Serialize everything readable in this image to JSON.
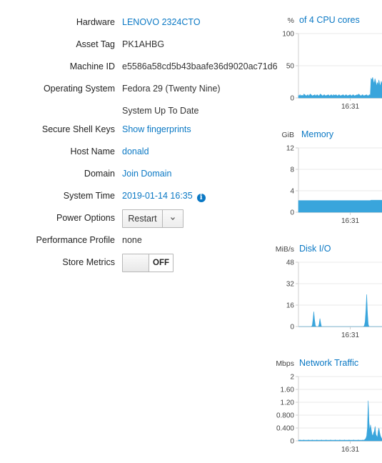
{
  "system": {
    "hardware": {
      "label": "Hardware",
      "value": "LENOVO 2324CTO"
    },
    "asset_tag": {
      "label": "Asset Tag",
      "value": "PK1AHBG"
    },
    "machine_id": {
      "label": "Machine ID",
      "value": "e5586a58cd5b43baafe36d9020ac71d6"
    },
    "os": {
      "label": "Operating System",
      "value": "Fedora 29 (Twenty Nine)",
      "status": "System Up To Date"
    },
    "ssh": {
      "label": "Secure Shell Keys",
      "value": "Show fingerprints"
    },
    "host": {
      "label": "Host Name",
      "value": "donald"
    },
    "domain": {
      "label": "Domain",
      "value": "Join Domain"
    },
    "time": {
      "label": "System Time",
      "value": "2019-01-14 16:35",
      "info_icon": "info-icon"
    },
    "power": {
      "label": "Power Options",
      "button": "Restart",
      "caret_icon": "chevron-down-icon"
    },
    "profile": {
      "label": "Performance Profile",
      "value": "none"
    },
    "metrics": {
      "label": "Store Metrics",
      "state": "OFF"
    }
  },
  "colors": {
    "link": "#0a78c4",
    "area": "#39a5dc"
  },
  "chart_data": [
    {
      "type": "area",
      "unit": "%",
      "title": "of 4 CPU cores",
      "y_ticks": [
        "100",
        "50",
        "0"
      ],
      "ylim": [
        0,
        100
      ],
      "x_tick": "16:31",
      "values": [
        4,
        3,
        5,
        3,
        4,
        4,
        3,
        6,
        5,
        4,
        3,
        4,
        5,
        3,
        4,
        6,
        5,
        4,
        3,
        4,
        4,
        5,
        3,
        4,
        5,
        4,
        3,
        4,
        6,
        5,
        4,
        3,
        4,
        5,
        4,
        3,
        4,
        4,
        5,
        4,
        3,
        4,
        5,
        4,
        3,
        5,
        4,
        4,
        5,
        4,
        3,
        4,
        5,
        4,
        3,
        4,
        4,
        5,
        4,
        3,
        4,
        5,
        4,
        3,
        4,
        4,
        5,
        4,
        3,
        4,
        5,
        4,
        3,
        4,
        4,
        5,
        4,
        6,
        5,
        4,
        3,
        4,
        5,
        4,
        3,
        4,
        4,
        5,
        4,
        3,
        4,
        5,
        4,
        30,
        28,
        32,
        26,
        22,
        30,
        25,
        18,
        24,
        20,
        28,
        22,
        18,
        26,
        22
      ]
    },
    {
      "type": "area",
      "unit": "GiB",
      "title": "Memory",
      "y_ticks": [
        "12",
        "8",
        "4",
        "0"
      ],
      "ylim": [
        0,
        16
      ],
      "x_tick": "16:31",
      "values": [
        2.9,
        2.9,
        2.9,
        2.9,
        2.9,
        2.9,
        2.9,
        2.9,
        2.9,
        2.9,
        2.9,
        2.9,
        2.9,
        2.9,
        2.9,
        2.9,
        2.9,
        2.9,
        2.9,
        2.9,
        2.9,
        2.9,
        2.9,
        2.9,
        2.9,
        2.9,
        2.9,
        2.9,
        2.9,
        2.9,
        2.9,
        2.9,
        2.9,
        2.9,
        2.9,
        2.9,
        2.9,
        2.9,
        2.9,
        2.9,
        2.9,
        2.9,
        2.9,
        2.9,
        2.9,
        2.9,
        2.9,
        2.9,
        2.9,
        2.9,
        2.9,
        2.9,
        2.9,
        2.9,
        2.9,
        2.9,
        2.9,
        2.9,
        2.9,
        2.9,
        2.9,
        2.9,
        2.9,
        2.9,
        2.9,
        2.9,
        2.9,
        2.9,
        2.9,
        2.9,
        2.9,
        2.9,
        2.9,
        2.9,
        2.9,
        2.9,
        2.9,
        2.9,
        2.9,
        2.9,
        2.9,
        2.9,
        2.9,
        2.9,
        2.9,
        2.9,
        2.9,
        2.9,
        2.9,
        2.9,
        2.9,
        2.9,
        2.9,
        3.0,
        3.0,
        3.0,
        3.0,
        3.0,
        3.0,
        3.0,
        3.0,
        3.0,
        3.0,
        3.0,
        3.0,
        3.0,
        3.0,
        3.0
      ]
    },
    {
      "type": "area",
      "unit": "MiB/s",
      "title": "Disk I/O",
      "y_ticks": [
        "48",
        "32",
        "16",
        "0"
      ],
      "ylim": [
        0,
        56
      ],
      "x_tick": "16:31",
      "values": [
        0,
        0,
        0,
        0,
        0,
        0,
        0,
        0,
        0,
        0,
        0,
        0,
        0,
        0,
        0,
        0,
        0,
        0,
        1,
        6,
        13,
        6,
        1,
        0,
        0,
        0,
        0,
        2,
        7,
        3,
        0,
        0,
        0,
        0,
        0,
        0,
        0,
        0,
        0,
        0,
        0,
        0,
        0,
        0,
        0,
        0,
        0,
        0,
        0,
        0,
        0,
        0,
        0,
        0,
        0,
        0,
        0,
        0,
        0,
        0,
        0,
        0,
        0,
        0,
        0,
        0,
        0,
        0,
        0,
        0,
        0,
        0,
        0,
        0,
        0,
        0,
        0,
        0,
        0,
        0,
        0,
        0,
        0,
        0,
        0,
        0,
        1,
        4,
        14,
        28,
        12,
        2,
        0,
        0,
        0,
        0,
        0,
        0,
        0,
        0,
        0,
        0,
        0,
        0,
        0,
        0,
        0,
        0,
        0,
        0
      ]
    },
    {
      "type": "area",
      "unit": "Mbps",
      "title": "Network Traffic",
      "y_ticks": [
        "2",
        "1.60",
        "1.20",
        "0.800",
        "0.400",
        "0"
      ],
      "ylim": [
        0,
        2
      ],
      "x_tick": "16:31",
      "values": [
        0.02,
        0.02,
        0.03,
        0.02,
        0.02,
        0.02,
        0.02,
        0.03,
        0.02,
        0.02,
        0.02,
        0.02,
        0.02,
        0.03,
        0.02,
        0.02,
        0.02,
        0.02,
        0.03,
        0.02,
        0.02,
        0.02,
        0.02,
        0.02,
        0.03,
        0.02,
        0.02,
        0.02,
        0.02,
        0.02,
        0.03,
        0.02,
        0.02,
        0.02,
        0.02,
        0.02,
        0.03,
        0.02,
        0.02,
        0.02,
        0.02,
        0.02,
        0.03,
        0.02,
        0.02,
        0.02,
        0.02,
        0.02,
        0.03,
        0.02,
        0.02,
        0.02,
        0.02,
        0.02,
        0.03,
        0.02,
        0.02,
        0.02,
        0.02,
        0.02,
        0.03,
        0.02,
        0.02,
        0.02,
        0.02,
        0.02,
        0.03,
        0.02,
        0.02,
        0.02,
        0.02,
        0.02,
        0.03,
        0.02,
        0.02,
        0.02,
        0.02,
        0.02,
        0.03,
        0.02,
        0.02,
        0.02,
        0.02,
        0.02,
        0.03,
        0.02,
        0.03,
        0.05,
        0.08,
        0.15,
        0.4,
        1.25,
        0.6,
        0.3,
        0.5,
        0.35,
        0.2,
        0.15,
        0.25,
        0.3,
        0.45,
        0.2,
        0.15,
        0.1,
        0.3,
        0.4,
        0.25,
        0.15,
        0.1,
        0.05
      ]
    }
  ]
}
